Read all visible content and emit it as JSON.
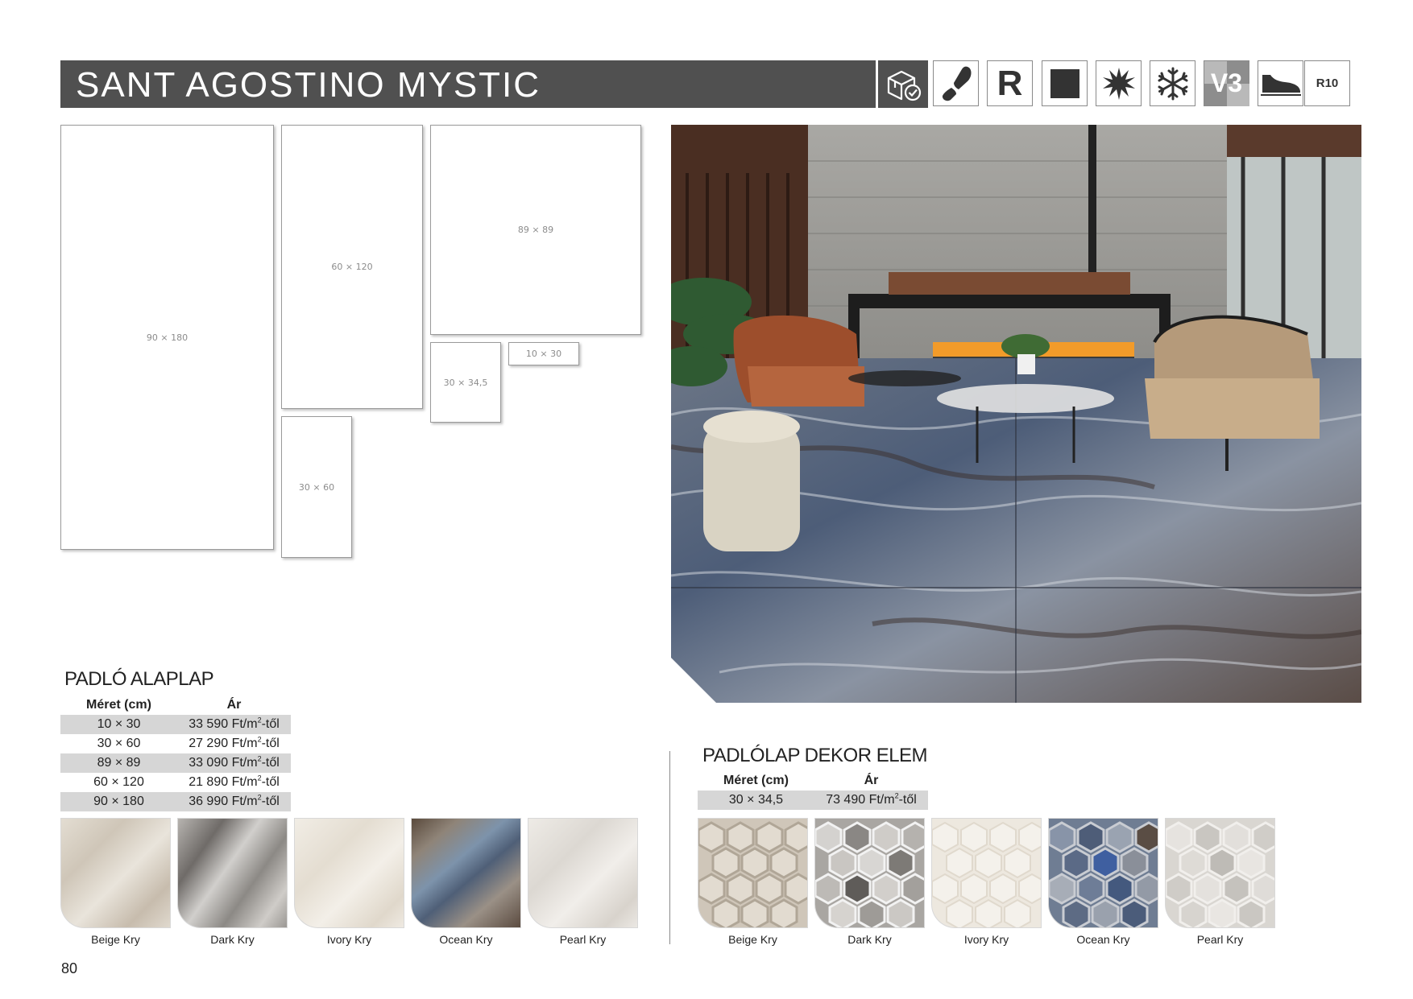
{
  "header": {
    "title": "SANT AGOSTINO MYSTIC",
    "icons": [
      {
        "name": "box-check-icon"
      },
      {
        "name": "footprint-icon"
      },
      {
        "name": "rectified-icon",
        "label": "R"
      },
      {
        "name": "matte-square-icon"
      },
      {
        "name": "frost-resistant-icon"
      },
      {
        "name": "snowflake-icon"
      },
      {
        "name": "shade-variation-icon",
        "label": "V3"
      },
      {
        "name": "shoe-slip-icon"
      },
      {
        "name": "slip-rating-icon",
        "label": "R10"
      }
    ]
  },
  "formats": [
    {
      "label": "90 × 180"
    },
    {
      "label": "60 × 120"
    },
    {
      "label": "89 × 89"
    },
    {
      "label": "30 × 34,5"
    },
    {
      "label": "10 × 30"
    },
    {
      "label": "30 × 60"
    }
  ],
  "floor_base": {
    "title": "PADLÓ ALAPLAP",
    "col_size": "Méret (cm)",
    "col_price": "Ár",
    "rows": [
      {
        "size": "10 × 30",
        "price": "33 590 Ft/m",
        "suffix": "-től"
      },
      {
        "size": "30 × 60",
        "price": "27 290 Ft/m",
        "suffix": "-től"
      },
      {
        "size": "89 × 89",
        "price": "33 090 Ft/m",
        "suffix": "-től"
      },
      {
        "size": "60 × 120",
        "price": "21 890 Ft/m",
        "suffix": "-től"
      },
      {
        "size": "90 × 180",
        "price": "36 990 Ft/m",
        "suffix": "-től"
      }
    ],
    "swatches": [
      "Beige Kry",
      "Dark Kry",
      "Ivory Kry",
      "Ocean Kry",
      "Pearl Kry"
    ]
  },
  "floor_decor": {
    "title": "PADLÓLAP DEKOR ELEM",
    "col_size": "Méret (cm)",
    "col_price": "Ár",
    "rows": [
      {
        "size": "30 × 34,5",
        "price": "73 490 Ft/m",
        "suffix": "-től"
      }
    ],
    "swatches": [
      "Beige Kry",
      "Dark Kry",
      "Ivory Kry",
      "Ocean Kry",
      "Pearl Kry"
    ]
  },
  "page_number": "80"
}
